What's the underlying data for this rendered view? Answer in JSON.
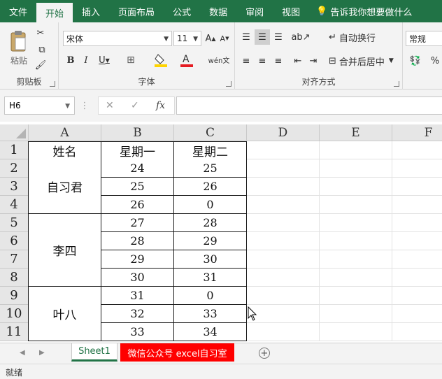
{
  "menu": {
    "tabs": [
      "文件",
      "开始",
      "插入",
      "页面布局",
      "公式",
      "数据",
      "审阅",
      "视图"
    ],
    "active_index": 1,
    "tell_me": "告诉我你想要做什么"
  },
  "ribbon": {
    "clipboard": {
      "label": "剪贴板",
      "paste": "粘贴"
    },
    "font": {
      "label": "字体",
      "font_name": "宋体",
      "font_size": "11"
    },
    "alignment": {
      "label": "对齐方式",
      "wrap_text": "自动换行",
      "merge_center": "合并后居中"
    },
    "number": {
      "format": "常规"
    }
  },
  "formula_bar": {
    "name_box": "H6",
    "fx": "fx",
    "formula": ""
  },
  "grid": {
    "columns": [
      "A",
      "B",
      "C",
      "D",
      "E",
      "F"
    ],
    "rows": [
      "1",
      "2",
      "3",
      "4",
      "5",
      "6",
      "7",
      "8",
      "9",
      "10",
      "11"
    ],
    "header": [
      "姓名",
      "星期一",
      "星期二"
    ],
    "groups": [
      {
        "name": "自习君",
        "rows": [
          [
            24,
            25
          ],
          [
            25,
            26
          ],
          [
            26,
            0
          ]
        ]
      },
      {
        "name": "李四",
        "rows": [
          [
            27,
            28
          ],
          [
            28,
            29
          ],
          [
            29,
            30
          ],
          [
            30,
            31
          ]
        ]
      },
      {
        "name": "叶八",
        "rows": [
          [
            31,
            0
          ],
          [
            32,
            33
          ],
          [
            33,
            34
          ]
        ]
      }
    ]
  },
  "sheets": {
    "tabs": [
      "Sheet1",
      "微信公众号 excel自习室"
    ],
    "active_index": 0
  },
  "status": {
    "text": "就绪"
  },
  "colors": {
    "accent": "#217346",
    "sheet_tab_red": "#ff0000"
  }
}
